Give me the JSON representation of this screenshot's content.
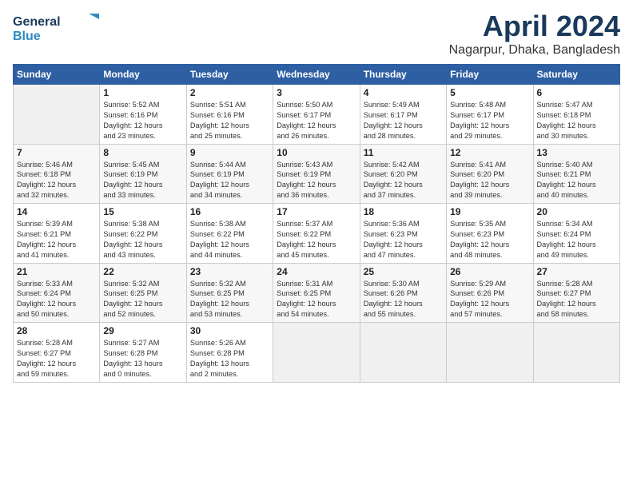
{
  "logo": {
    "general": "General",
    "blue": "Blue"
  },
  "title": "April 2024",
  "subtitle": "Nagarpur, Dhaka, Bangladesh",
  "days_header": [
    "Sunday",
    "Monday",
    "Tuesday",
    "Wednesday",
    "Thursday",
    "Friday",
    "Saturday"
  ],
  "weeks": [
    [
      {
        "day": "",
        "info": ""
      },
      {
        "day": "1",
        "info": "Sunrise: 5:52 AM\nSunset: 6:16 PM\nDaylight: 12 hours\nand 23 minutes."
      },
      {
        "day": "2",
        "info": "Sunrise: 5:51 AM\nSunset: 6:16 PM\nDaylight: 12 hours\nand 25 minutes."
      },
      {
        "day": "3",
        "info": "Sunrise: 5:50 AM\nSunset: 6:17 PM\nDaylight: 12 hours\nand 26 minutes."
      },
      {
        "day": "4",
        "info": "Sunrise: 5:49 AM\nSunset: 6:17 PM\nDaylight: 12 hours\nand 28 minutes."
      },
      {
        "day": "5",
        "info": "Sunrise: 5:48 AM\nSunset: 6:17 PM\nDaylight: 12 hours\nand 29 minutes."
      },
      {
        "day": "6",
        "info": "Sunrise: 5:47 AM\nSunset: 6:18 PM\nDaylight: 12 hours\nand 30 minutes."
      }
    ],
    [
      {
        "day": "7",
        "info": "Sunrise: 5:46 AM\nSunset: 6:18 PM\nDaylight: 12 hours\nand 32 minutes."
      },
      {
        "day": "8",
        "info": "Sunrise: 5:45 AM\nSunset: 6:19 PM\nDaylight: 12 hours\nand 33 minutes."
      },
      {
        "day": "9",
        "info": "Sunrise: 5:44 AM\nSunset: 6:19 PM\nDaylight: 12 hours\nand 34 minutes."
      },
      {
        "day": "10",
        "info": "Sunrise: 5:43 AM\nSunset: 6:19 PM\nDaylight: 12 hours\nand 36 minutes."
      },
      {
        "day": "11",
        "info": "Sunrise: 5:42 AM\nSunset: 6:20 PM\nDaylight: 12 hours\nand 37 minutes."
      },
      {
        "day": "12",
        "info": "Sunrise: 5:41 AM\nSunset: 6:20 PM\nDaylight: 12 hours\nand 39 minutes."
      },
      {
        "day": "13",
        "info": "Sunrise: 5:40 AM\nSunset: 6:21 PM\nDaylight: 12 hours\nand 40 minutes."
      }
    ],
    [
      {
        "day": "14",
        "info": "Sunrise: 5:39 AM\nSunset: 6:21 PM\nDaylight: 12 hours\nand 41 minutes."
      },
      {
        "day": "15",
        "info": "Sunrise: 5:38 AM\nSunset: 6:22 PM\nDaylight: 12 hours\nand 43 minutes."
      },
      {
        "day": "16",
        "info": "Sunrise: 5:38 AM\nSunset: 6:22 PM\nDaylight: 12 hours\nand 44 minutes."
      },
      {
        "day": "17",
        "info": "Sunrise: 5:37 AM\nSunset: 6:22 PM\nDaylight: 12 hours\nand 45 minutes."
      },
      {
        "day": "18",
        "info": "Sunrise: 5:36 AM\nSunset: 6:23 PM\nDaylight: 12 hours\nand 47 minutes."
      },
      {
        "day": "19",
        "info": "Sunrise: 5:35 AM\nSunset: 6:23 PM\nDaylight: 12 hours\nand 48 minutes."
      },
      {
        "day": "20",
        "info": "Sunrise: 5:34 AM\nSunset: 6:24 PM\nDaylight: 12 hours\nand 49 minutes."
      }
    ],
    [
      {
        "day": "21",
        "info": "Sunrise: 5:33 AM\nSunset: 6:24 PM\nDaylight: 12 hours\nand 50 minutes."
      },
      {
        "day": "22",
        "info": "Sunrise: 5:32 AM\nSunset: 6:25 PM\nDaylight: 12 hours\nand 52 minutes."
      },
      {
        "day": "23",
        "info": "Sunrise: 5:32 AM\nSunset: 6:25 PM\nDaylight: 12 hours\nand 53 minutes."
      },
      {
        "day": "24",
        "info": "Sunrise: 5:31 AM\nSunset: 6:25 PM\nDaylight: 12 hours\nand 54 minutes."
      },
      {
        "day": "25",
        "info": "Sunrise: 5:30 AM\nSunset: 6:26 PM\nDaylight: 12 hours\nand 55 minutes."
      },
      {
        "day": "26",
        "info": "Sunrise: 5:29 AM\nSunset: 6:26 PM\nDaylight: 12 hours\nand 57 minutes."
      },
      {
        "day": "27",
        "info": "Sunrise: 5:28 AM\nSunset: 6:27 PM\nDaylight: 12 hours\nand 58 minutes."
      }
    ],
    [
      {
        "day": "28",
        "info": "Sunrise: 5:28 AM\nSunset: 6:27 PM\nDaylight: 12 hours\nand 59 minutes."
      },
      {
        "day": "29",
        "info": "Sunrise: 5:27 AM\nSunset: 6:28 PM\nDaylight: 13 hours\nand 0 minutes."
      },
      {
        "day": "30",
        "info": "Sunrise: 5:26 AM\nSunset: 6:28 PM\nDaylight: 13 hours\nand 2 minutes."
      },
      {
        "day": "",
        "info": ""
      },
      {
        "day": "",
        "info": ""
      },
      {
        "day": "",
        "info": ""
      },
      {
        "day": "",
        "info": ""
      }
    ]
  ]
}
